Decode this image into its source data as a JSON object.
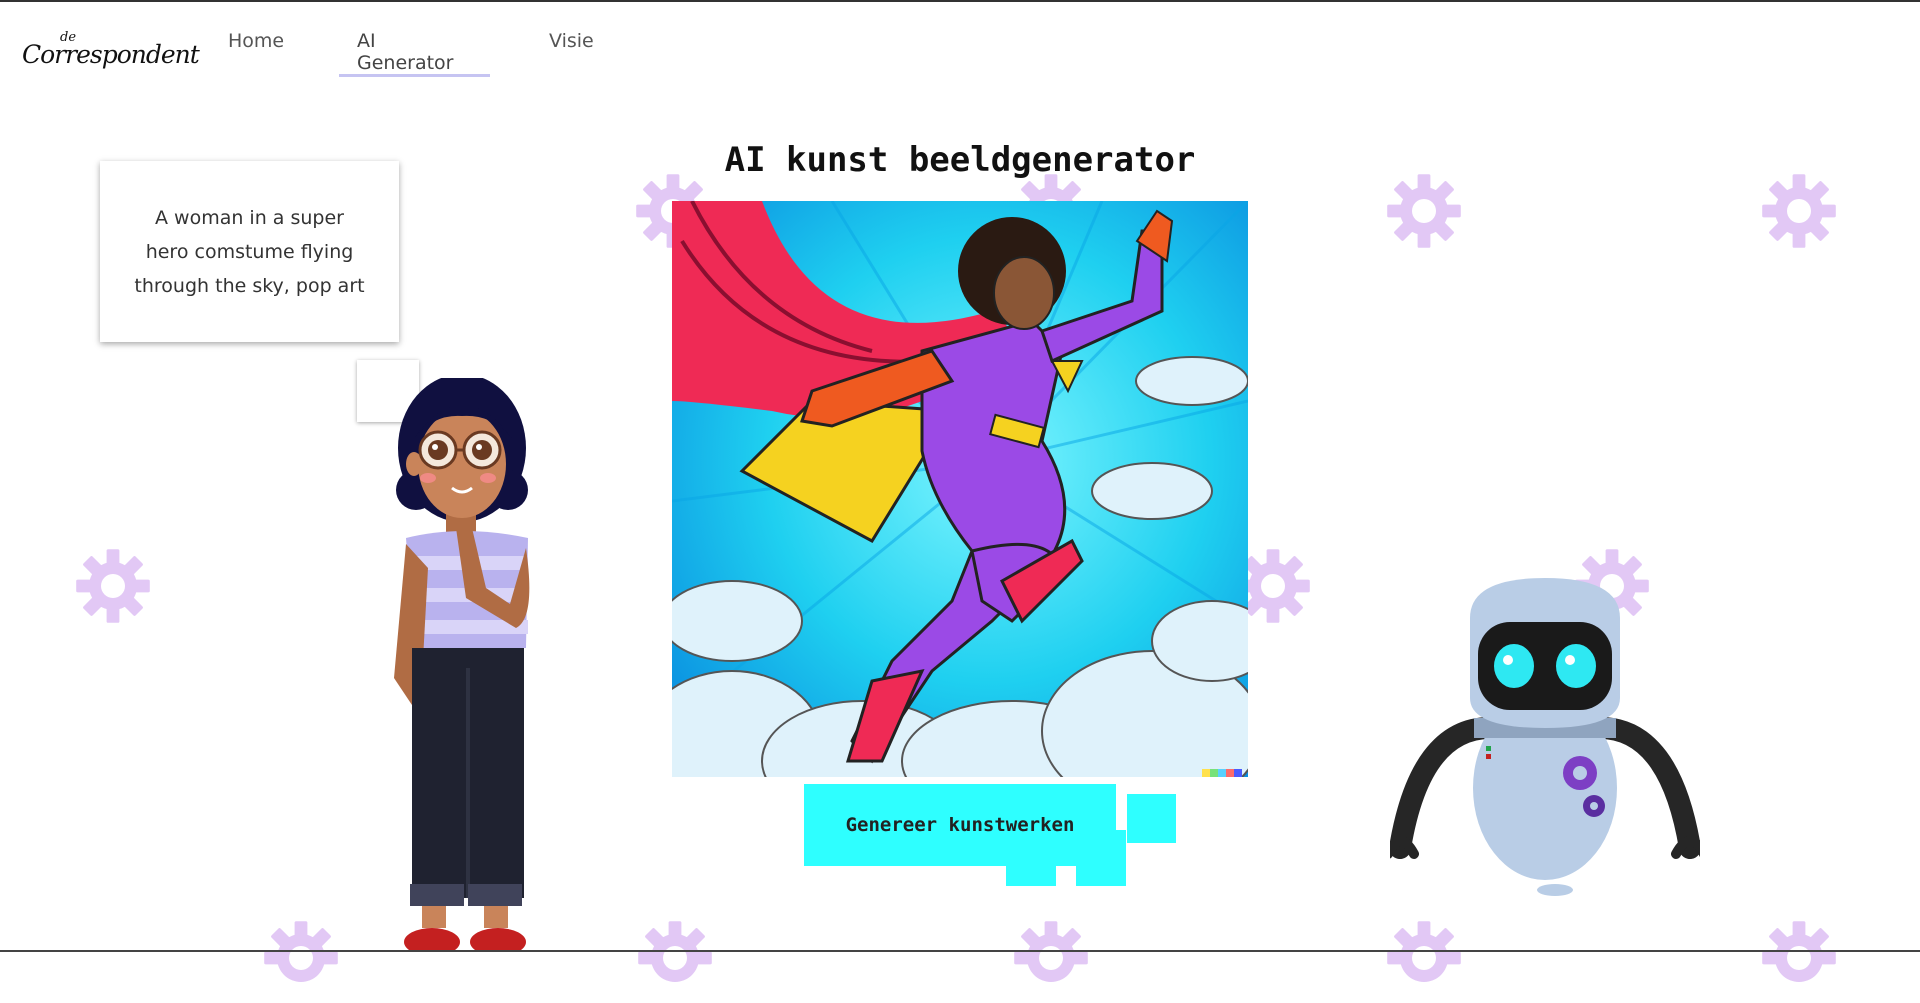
{
  "header": {
    "logo_small": "de",
    "logo_big": "Correspondent",
    "nav": [
      {
        "label": "Home"
      },
      {
        "label": "AI Generator",
        "active": true
      },
      {
        "label": "Visie"
      }
    ]
  },
  "main": {
    "title": "AI kunst beeldgenerator",
    "prompt": "A woman in a super hero comstume flying through the sky, pop art",
    "generate_label": "Genereer kunstwerken"
  },
  "colors": {
    "accent": "#2effff",
    "gear": "#e2c8f5",
    "nav_active_underline": "#c6c4f2",
    "robot_eye": "#2ee8f2",
    "robot_gear": "#7d3fc4"
  },
  "icons": [
    "gear-icon"
  ]
}
